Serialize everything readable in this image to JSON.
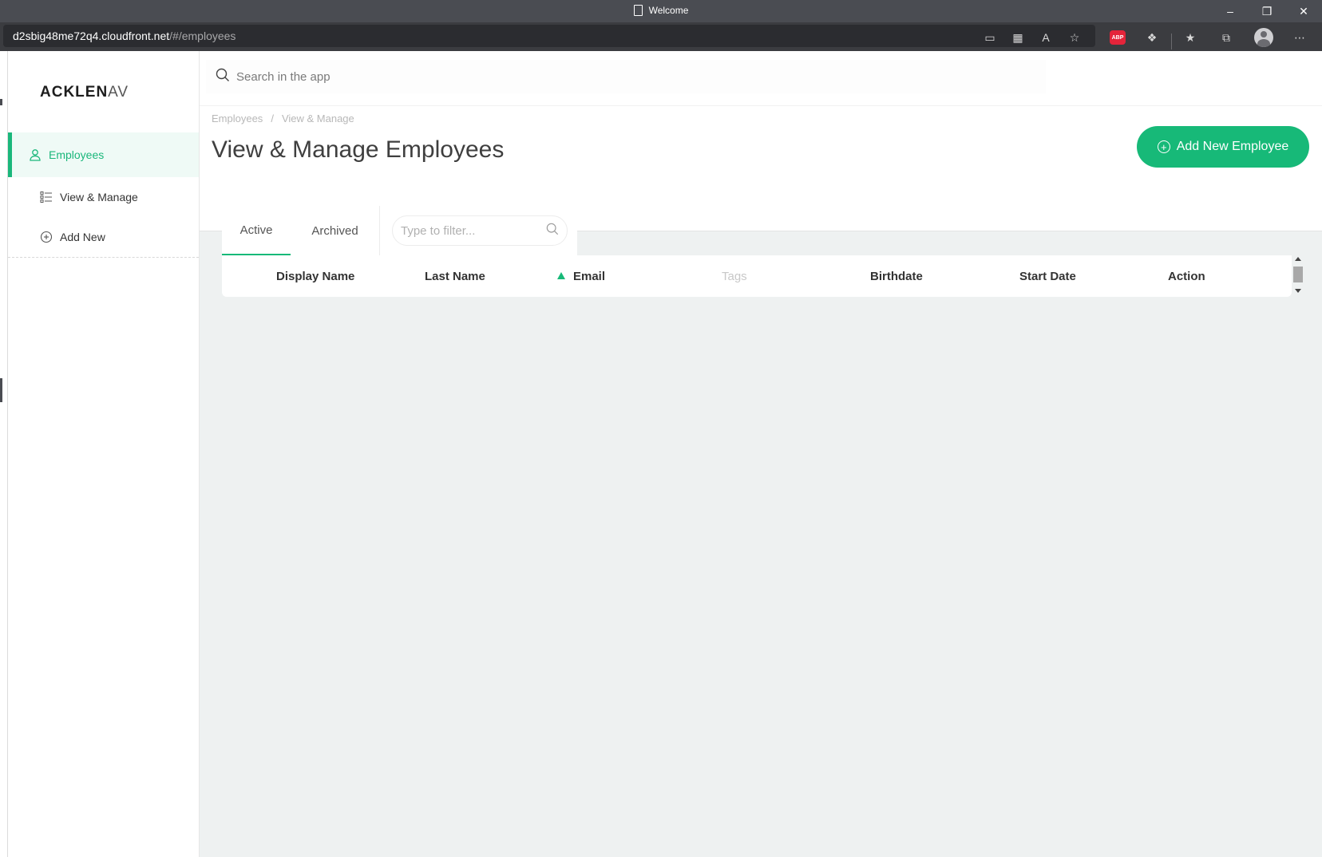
{
  "browser": {
    "window_title": "Welcome",
    "url_host": "d2sbig48me72q4.cloudfront.net",
    "url_path": "/#/employees",
    "extension_abp": "ABP"
  },
  "sidebar": {
    "logo_main": "ACKLEN",
    "logo_faded": "AV",
    "items": [
      {
        "label": "Employees",
        "icon": "user-icon",
        "active": true
      },
      {
        "label": "View & Manage",
        "icon": "list-icon",
        "active": false
      },
      {
        "label": "Add New",
        "icon": "plus-circle-icon",
        "active": false
      }
    ]
  },
  "topbar": {
    "search_placeholder": "Search in the app"
  },
  "header": {
    "breadcrumb": [
      "Employees",
      "View & Manage"
    ],
    "breadcrumb_separator": "/",
    "title": "View & Manage Employees",
    "add_button": "Add New Employee"
  },
  "table": {
    "tabs": [
      {
        "label": "Active",
        "active": true
      },
      {
        "label": "Archived",
        "active": false
      }
    ],
    "filter_placeholder": "Type to filter...",
    "columns": [
      {
        "label": "Display Name"
      },
      {
        "label": "Last Name"
      },
      {
        "label": "Email",
        "sorted": "asc"
      },
      {
        "label": "Tags",
        "muted": true
      },
      {
        "label": "Birthdate"
      },
      {
        "label": "Start Date"
      },
      {
        "label": "Action"
      }
    ],
    "rows": []
  },
  "colors": {
    "accent": "#17b978",
    "sidebar_active_bg": "#effaf6",
    "content_bg": "#eef1f1"
  }
}
